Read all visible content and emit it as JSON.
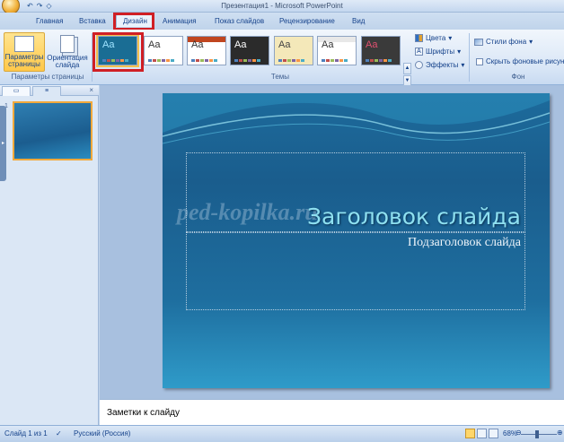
{
  "window": {
    "title": "Презентация1 - Microsoft PowerPoint",
    "qat": [
      "↶",
      "↷",
      "◇"
    ]
  },
  "tabs": [
    {
      "label": "Главная"
    },
    {
      "label": "Вставка"
    },
    {
      "label": "Дизайн",
      "active": true
    },
    {
      "label": "Анимация"
    },
    {
      "label": "Показ слайдов"
    },
    {
      "label": "Рецензирование"
    },
    {
      "label": "Вид"
    }
  ],
  "ribbon": {
    "page_setup": {
      "params_label": "Параметры страницы",
      "orientation_label": "Ориентация слайда",
      "group_label": "Параметры страницы"
    },
    "themes": {
      "group_label": "Темы",
      "aa": "Aa",
      "items": [
        {
          "bg": "#1a6d94",
          "fg": "#9fe3ff",
          "selected": true
        },
        {
          "bg": "#ffffff",
          "fg": "#333333"
        },
        {
          "bg": "#ffffff",
          "fg": "#333333",
          "band": "#c0461f"
        },
        {
          "bg": "#2b2b2b",
          "fg": "#ffffff"
        },
        {
          "bg": "#f4e8b9",
          "fg": "#444444"
        },
        {
          "bg": "#ffffff",
          "fg": "#333333",
          "band": "#e8e8e8"
        },
        {
          "bg": "#3a3a3a",
          "fg": "#e05070"
        }
      ],
      "scroll": [
        "▲",
        "▼",
        "▾"
      ]
    },
    "theme_cmds": {
      "colors": "Цвета",
      "fonts": "Шрифты",
      "effects": "Эффекты"
    },
    "background": {
      "styles": "Стили фона",
      "hide": "Скрыть фоновые рисунки",
      "group_label": "Фон"
    }
  },
  "left_panel": {
    "slide_number": "1",
    "close": "×",
    "handle": "▸"
  },
  "slide": {
    "title": "Заголовок слайда",
    "subtitle": "Подзаголовок слайда",
    "watermark": "ped-kopilka.ru"
  },
  "notes": {
    "placeholder": "Заметки к слайду"
  },
  "status": {
    "slide_info": "Слайд 1 из 1",
    "language": "Русский (Россия)",
    "zoom": "68%",
    "zoom_minus": "⊖",
    "zoom_plus": "⊕"
  },
  "colors": {
    "highlight": "#d01f25",
    "ribbon_text": "#15428b",
    "slide_title": "#8ee0f0"
  }
}
